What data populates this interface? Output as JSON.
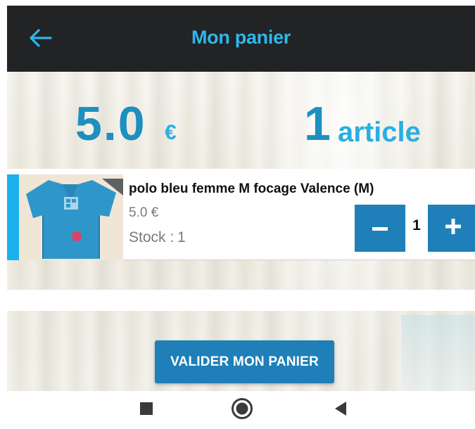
{
  "header": {
    "title": "Mon panier",
    "back_icon": "arrow-left-icon"
  },
  "summary": {
    "total": "5.0",
    "currency": "€",
    "count": "1",
    "count_label": "article"
  },
  "cart": {
    "items": [
      {
        "name": "polo bleu femme M focage Valence (M)",
        "price": "5.0 €",
        "stock_label": "Stock :",
        "stock_value": "1",
        "quantity": "1",
        "thumbnail_icon": "blue-polo-shirt-image"
      }
    ]
  },
  "actions": {
    "validate_label": "VALIDER MON PANIER"
  },
  "system_nav": {
    "recents_icon": "square-recents-icon",
    "home_icon": "circle-home-icon",
    "back_icon": "triangle-back-icon"
  },
  "colors": {
    "appbar_bg": "#212325",
    "accent": "#2fb7ea",
    "primary_button": "#1f7fb9",
    "amount_text": "#1d8fc0"
  }
}
